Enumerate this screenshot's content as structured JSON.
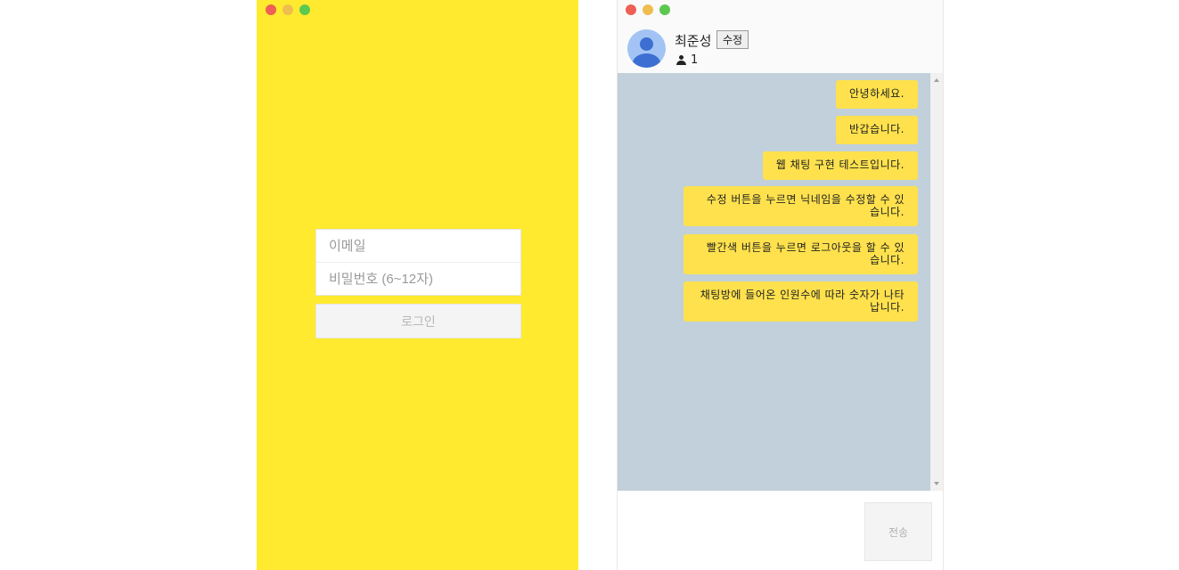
{
  "login": {
    "email_placeholder": "이메일",
    "password_placeholder": "비밀번호 (6~12자)",
    "login_label": "로그인",
    "background_color": "#ffea2f"
  },
  "chat": {
    "user_name": "최준성",
    "edit_label": "수정",
    "member_count": "1",
    "messages": [
      "안녕하세요.",
      "반갑습니다.",
      "웹 채팅 구현 테스트입니다.",
      "수정 버튼을 누르면 닉네임을 수정할 수 있습니다.",
      "빨간색 버튼을 누르면 로그아웃을 할 수 있습니다.",
      "채팅방에 들어온 인원수에 따라 숫자가 나타납니다."
    ],
    "send_label": "전송",
    "bubble_color": "#fee14d",
    "chat_background_color": "#c1d0da"
  }
}
